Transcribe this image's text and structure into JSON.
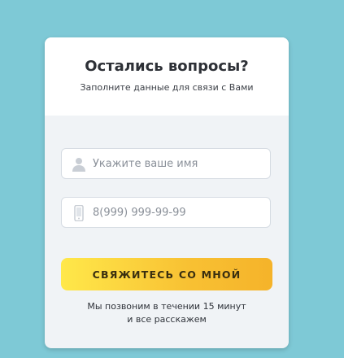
{
  "form": {
    "title": "Остались вопросы?",
    "subtitle": "Заполните данные для связи с Вами",
    "name_field": {
      "placeholder": "Укажите ваше имя",
      "value": ""
    },
    "phone_field": {
      "placeholder": "8(999) 999-99-99",
      "value": ""
    },
    "submit_label": "СВЯЖИТЕСЬ СО МНОЙ",
    "note_line1": "Мы позвоним в течении 15 минут",
    "note_line2": "и все расскажем"
  },
  "icons": {
    "name": "user-icon",
    "phone": "phone-icon"
  },
  "colors": {
    "background": "#7ec9d6",
    "card_body": "#f0f3f6",
    "cta_start": "#ffe84a",
    "cta_end": "#f5b32a"
  }
}
